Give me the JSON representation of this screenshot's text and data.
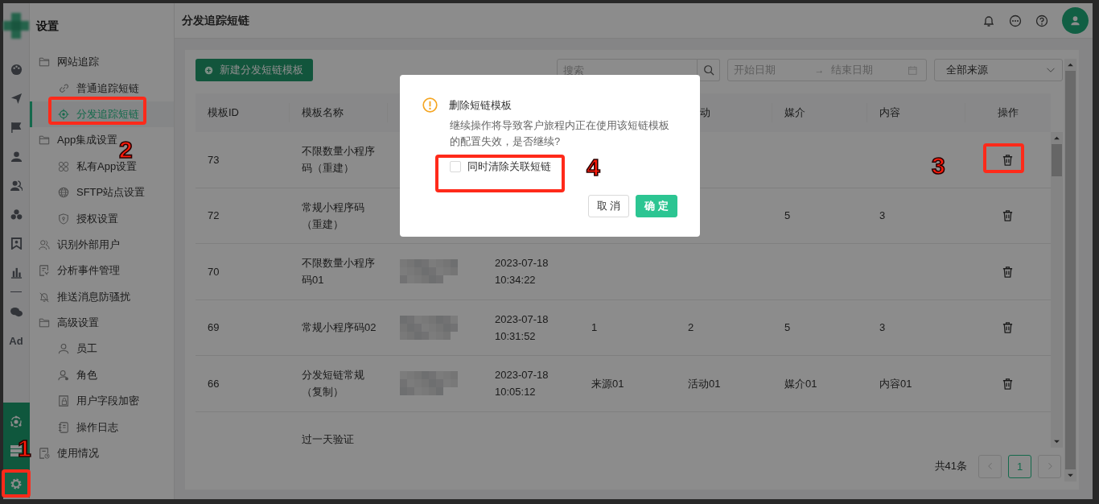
{
  "rail": {
    "items": [
      {
        "selected": false
      },
      {
        "selected": false
      },
      {
        "selected": false
      },
      {
        "selected": false
      },
      {
        "selected": false
      },
      {
        "selected": false
      },
      {
        "selected": false
      },
      {
        "selected": false
      },
      {
        "selected": false
      },
      {
        "label": "Ad",
        "selected": false
      }
    ],
    "bottom_items": [
      {
        "selected": false
      },
      {
        "selected": false
      },
      {
        "selected": true
      }
    ]
  },
  "sidebar": {
    "title": "设置",
    "items": [
      {
        "label": "网站追踪",
        "children": [
          {
            "label": "普通追踪短链",
            "selected": false
          },
          {
            "label": "分发追踪短链",
            "selected": true
          }
        ]
      },
      {
        "label": "App集成设置",
        "children": [
          {
            "label": "私有App设置",
            "selected": false
          },
          {
            "label": "SFTP站点设置",
            "selected": false
          },
          {
            "label": "授权设置",
            "selected": false
          }
        ]
      },
      {
        "label": "识别外部用户",
        "selected": false
      },
      {
        "label": "分析事件管理",
        "selected": false
      },
      {
        "label": "推送消息防骚扰",
        "selected": false
      },
      {
        "label": "高级设置",
        "children": [
          {
            "label": "员工",
            "selected": false
          },
          {
            "label": "角色",
            "selected": false
          },
          {
            "label": "用户字段加密",
            "selected": false
          },
          {
            "label": "操作日志",
            "selected": false
          }
        ]
      },
      {
        "label": "使用情况",
        "selected": false
      }
    ]
  },
  "header": {
    "title": "分发追踪短链"
  },
  "toolbar": {
    "new_button": "新建分发短链模板",
    "search": {
      "placeholder": "搜索"
    },
    "date_range": {
      "start_placeholder": "开始日期",
      "separator": "→",
      "end_placeholder": "结束日期"
    },
    "source_select": {
      "value": "全部来源"
    }
  },
  "table": {
    "columns": [
      {
        "label": "模板ID"
      },
      {
        "label": "模板名称"
      },
      {},
      {},
      {},
      {
        "label": "动"
      },
      {
        "label": "媒介"
      },
      {
        "label": "内容"
      },
      {
        "label": "操作"
      }
    ],
    "rows": [
      {
        "cells": [
          {
            "text": "73"
          },
          {
            "text": "不限数量小程序码（重建）"
          },
          {},
          {},
          {},
          {},
          {},
          {},
          {
            "kind": "delete"
          }
        ]
      },
      {
        "cells": [
          {
            "text": "72"
          },
          {
            "text": "常规小程序码（重建）"
          },
          {},
          {},
          {},
          {},
          {
            "text": "5"
          },
          {
            "text": "3"
          },
          {
            "kind": "delete"
          }
        ]
      },
      {
        "cells": [
          {
            "text": "70"
          },
          {
            "text": "不限数量小程序码01"
          },
          {
            "kind": "redacted"
          },
          {
            "text": "2023-07-18 10:34:22"
          },
          {},
          {},
          {},
          {},
          {
            "kind": "delete"
          }
        ]
      },
      {
        "cells": [
          {
            "text": "69"
          },
          {
            "text": "常规小程序码02"
          },
          {
            "kind": "redacted"
          },
          {
            "text": "2023-07-18 10:31:52"
          },
          {
            "text": "1"
          },
          {
            "text": "2"
          },
          {
            "text": "5"
          },
          {
            "text": "3"
          },
          {
            "kind": "delete"
          }
        ]
      },
      {
        "cells": [
          {
            "text": "66"
          },
          {
            "text": "分发短链常规（复制）"
          },
          {
            "kind": "redacted"
          },
          {
            "text": "2023-07-18 10:05:12"
          },
          {
            "text": "来源01"
          },
          {
            "text": "活动01"
          },
          {
            "text": "媒介01"
          },
          {
            "text": "内容01"
          },
          {
            "kind": "delete"
          }
        ]
      },
      {
        "cells": [
          {},
          {
            "text": "过一天验证"
          },
          {},
          {},
          {},
          {},
          {},
          {},
          {}
        ]
      }
    ]
  },
  "pagination": {
    "total": "共41条",
    "pages": [
      {
        "label": "1",
        "selected": true
      }
    ]
  },
  "dialog": {
    "title": "删除短链模板",
    "message": "继续操作将导致客户旅程内正在使用该短链模板的配置失效，是否继续?",
    "checkbox": {
      "label": "同时清除关联短链",
      "checked": false
    },
    "buttons": [
      {
        "label": "取 消",
        "kind": "default"
      },
      {
        "label": "确 定",
        "kind": "primary"
      }
    ]
  },
  "annotations": [
    {
      "label": "1"
    },
    {
      "label": "2"
    },
    {
      "label": "3"
    },
    {
      "label": "4"
    }
  ]
}
